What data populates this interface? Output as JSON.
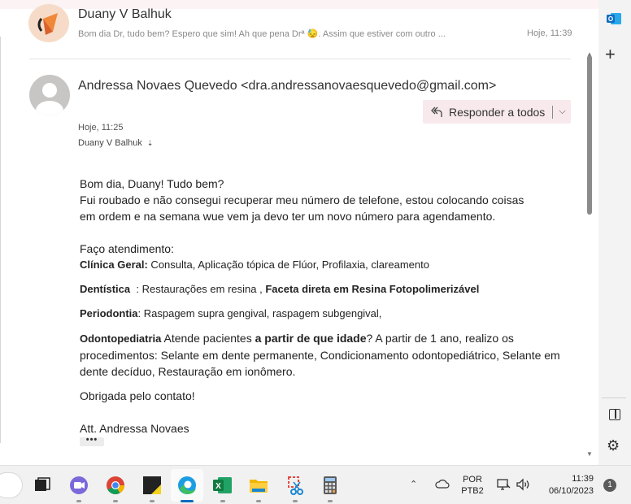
{
  "collapsed_message": {
    "sender": "Duany V Balhuk",
    "preview": "Bom dia Dr, tudo bem? Espero que sim! Ah que pena Drª 😓. Assim que estiver com outro ...",
    "time": "Hoje, 11:39"
  },
  "message": {
    "sender": "Andressa Novaes Quevedo <dra.andressanovaesquevedo@gmail.com>",
    "reply_all_label": "Responder a todos",
    "time": "Hoje, 11:25",
    "to": "Duany V Balhuk",
    "body": {
      "greeting": "Bom dia, Duany! Tudo bem?",
      "p1_line1": "Fui roubado e não consegui recuperar meu número de telefone, estou colocando coisas",
      "p1_line2": "em ordem e na semana wue vem ja devo ter um novo número para agendamento.",
      "intro": "Faço atendimento:",
      "clinica_label": "Clínica Geral:",
      "clinica_text": " Consulta, Aplicação tópica de Flúor, Profilaxia, clareamento",
      "dentistica_label": "Dentística",
      "dentistica_text": "  : Restaurações em resina , ",
      "dentistica_bold2": "Faceta direta em Resina Fotopolimerizável",
      "perio_label": "Periodontia",
      "perio_text": ": Raspagem supra gengival, raspagem subgengival,",
      "odonto_label": "Odontopediatria",
      "odonto_text1": " Atende pacientes ",
      "odonto_bold2": "a partir de que idade",
      "odonto_text2": "? A partir de 1 ano, realizo os procedimentos: Selante em dente permanente, Condicionamento odontopediátrico, Selante em dente decíduo, Restauração em ionômero.",
      "thanks": "Obrigada pelo contato!",
      "signature": "Att. Andressa Novaes",
      "expand": "•••"
    }
  },
  "taskbar": {
    "tray_lang_1": "POR",
    "tray_lang_2": "PTB2",
    "time": "11:39",
    "date": "06/10/2023",
    "notification_count": "1"
  },
  "colors": {
    "reply_bg": "#f7e9ec",
    "outlook_blue": "#0f6cbd"
  }
}
